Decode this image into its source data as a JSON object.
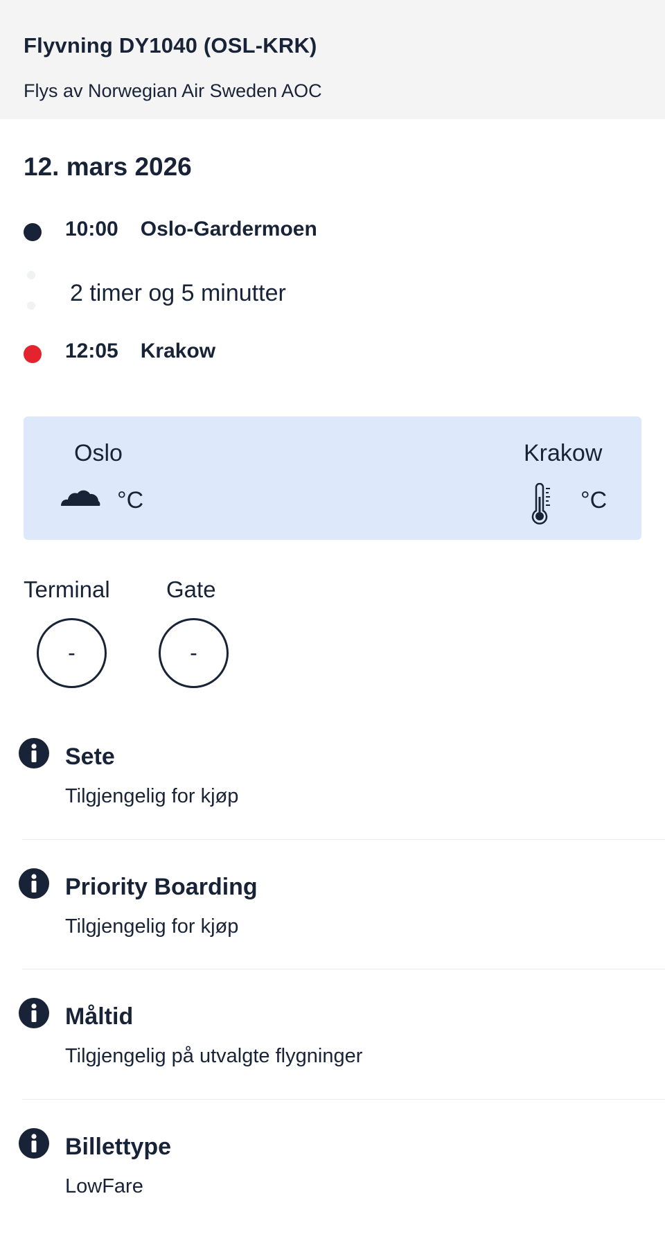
{
  "header": {
    "title": "Flyvning DY1040 (OSL-KRK)",
    "operator": "Flys av Norwegian Air Sweden AOC"
  },
  "flight": {
    "date": "12. mars 2026",
    "departure": {
      "time": "10:00",
      "airport": "Oslo-Gardermoen"
    },
    "duration": "2 timer og 5 minutter",
    "arrival": {
      "time": "12:05",
      "airport": "Krakow"
    }
  },
  "weather": {
    "origin": {
      "city": "Oslo",
      "icon": "cloud-icon",
      "unit": "°C"
    },
    "destination": {
      "city": "Krakow",
      "icon": "thermometer-icon",
      "unit": "°C"
    }
  },
  "terminal": {
    "label": "Terminal",
    "value": "-"
  },
  "gate": {
    "label": "Gate",
    "value": "-"
  },
  "info_items": [
    {
      "title": "Sete",
      "value": "Tilgjengelig for kjøp",
      "icon": "info-icon"
    },
    {
      "title": "Priority Boarding",
      "value": "Tilgjengelig for kjøp",
      "icon": "info-icon"
    },
    {
      "title": "Måltid",
      "value": "Tilgjengelig på utvalgte flygninger",
      "icon": "info-icon"
    },
    {
      "title": "Billettype",
      "value": "LowFare",
      "icon": "info-icon"
    }
  ],
  "colors": {
    "text": "#192337",
    "arrival_dot": "#e3242f",
    "weather_bg": "#dde9fb",
    "header_bg": "#f4f4f5"
  }
}
